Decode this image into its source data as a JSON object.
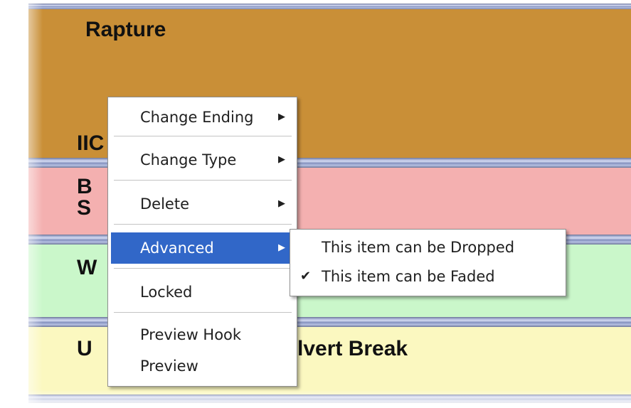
{
  "tracks": [
    {
      "title": "Rapture",
      "color": "#c98f37"
    },
    {
      "title": "IIC",
      "color": "#c98f37"
    },
    {
      "title": "B",
      "color": "#f4b0b0"
    },
    {
      "title": "S",
      "color": "#f4b0b0"
    },
    {
      "title": "W",
      "color": "#caf7ca"
    },
    {
      "title": "U",
      "color": "#fbf8c0"
    },
    {
      "title": "lvert Break",
      "color": "#fbf8c0"
    }
  ],
  "context_menu": {
    "items": [
      {
        "label": "Change Ending",
        "arrow": "▶"
      },
      {
        "label": "Change Type",
        "arrow": "▶"
      },
      {
        "label": "Delete",
        "arrow": "▶"
      },
      {
        "label": "Advanced",
        "arrow": "▶",
        "highlighted": true
      },
      {
        "label": "Locked"
      },
      {
        "label": "Preview Hook"
      },
      {
        "label": "Preview"
      }
    ]
  },
  "submenu": {
    "items": [
      {
        "label": "This item can be Dropped",
        "checked": false
      },
      {
        "label": "This item can be Faded",
        "checked": true,
        "check": "✔"
      }
    ]
  },
  "colors": {
    "highlight": "#3167c8",
    "orange": "#c98f37",
    "pink": "#f4b0b0",
    "green": "#caf7ca",
    "yellow": "#fbf8c0"
  }
}
